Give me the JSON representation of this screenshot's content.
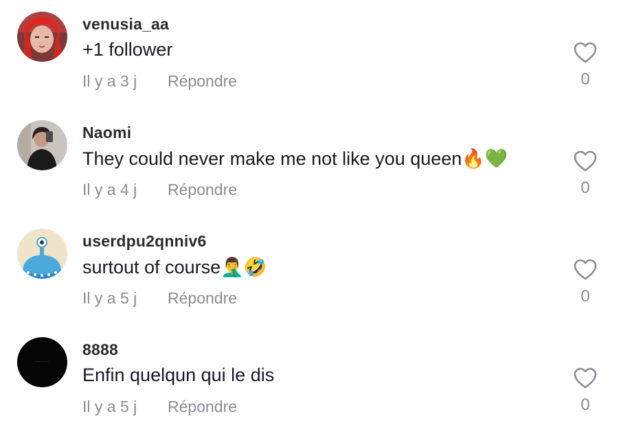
{
  "comments": [
    {
      "username": "venusia_aa",
      "text": "+1 follower",
      "time": "Il y a 3 j",
      "reply": "Répondre",
      "likes": "0",
      "avatar_icon": "red-haired-person-avatar"
    },
    {
      "username": "Naomi",
      "text": "They could never make me not like you queen🔥💚",
      "time": "Il y a 4 j",
      "reply": "Répondre",
      "likes": "0",
      "avatar_icon": "mirror-selfie-avatar"
    },
    {
      "username": "userdpu2qnniv6",
      "text": "surtout of course🤦‍♂️🤣",
      "time": "Il y a 5 j",
      "reply": "Répondre",
      "likes": "0",
      "avatar_icon": "blue-alien-avatar"
    },
    {
      "username": "8888",
      "text": "Enfin quelqun qui le dis",
      "time": "Il y a 5 j",
      "reply": "Répondre",
      "likes": "0",
      "avatar_icon": "black-avatar"
    }
  ],
  "colors": {
    "username": "#2b2b2b",
    "text": "#161823",
    "muted": "#8a8b91"
  }
}
